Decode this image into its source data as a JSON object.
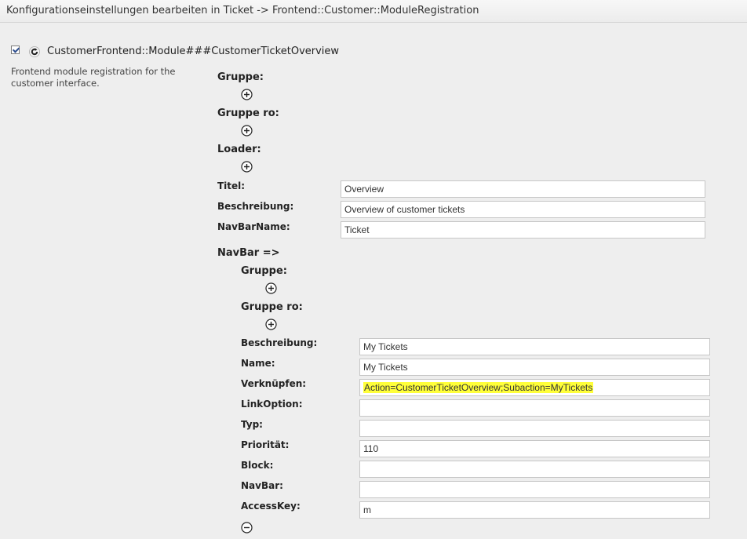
{
  "header": {
    "title": "Konfigurationseinstellungen bearbeiten in Ticket -> Frontend::Customer::ModuleRegistration"
  },
  "setting": {
    "name": "CustomerFrontend::Module###CustomerTicketOverview",
    "description": "Frontend module registration for the customer interface.",
    "checked": true
  },
  "labels": {
    "gruppe": "Gruppe:",
    "gruppe_ro": "Gruppe ro:",
    "loader": "Loader:",
    "titel": "Titel:",
    "beschreibung": "Beschreibung:",
    "navbarname": "NavBarName:",
    "navbar_section": "NavBar =>"
  },
  "fields": {
    "titel": "Overview",
    "beschreibung": "Overview of customer tickets",
    "navbarname": "Ticket"
  },
  "navbar": {
    "labels": {
      "gruppe": "Gruppe:",
      "gruppe_ro": "Gruppe ro:",
      "beschreibung": "Beschreibung:",
      "name": "Name:",
      "verknuepfen": "Verknüpfen:",
      "linkoption": "LinkOption:",
      "typ": "Typ:",
      "prioritaet": "Priorität:",
      "block": "Block:",
      "navbar": "NavBar:",
      "accesskey": "AccessKey:"
    },
    "fields": {
      "beschreibung": "My Tickets",
      "name": "My Tickets",
      "verknuepfen": "Action=CustomerTicketOverview;Subaction=MyTickets",
      "linkoption": "",
      "typ": "",
      "prioritaet": "110",
      "block": "",
      "navbar": "",
      "accesskey": "m"
    }
  },
  "colors": {
    "highlight": "#ffff3a",
    "background": "#eeeeee"
  },
  "icons": {
    "reset": "reset-icon",
    "add": "plus-circle-icon",
    "remove": "minus-circle-icon"
  }
}
